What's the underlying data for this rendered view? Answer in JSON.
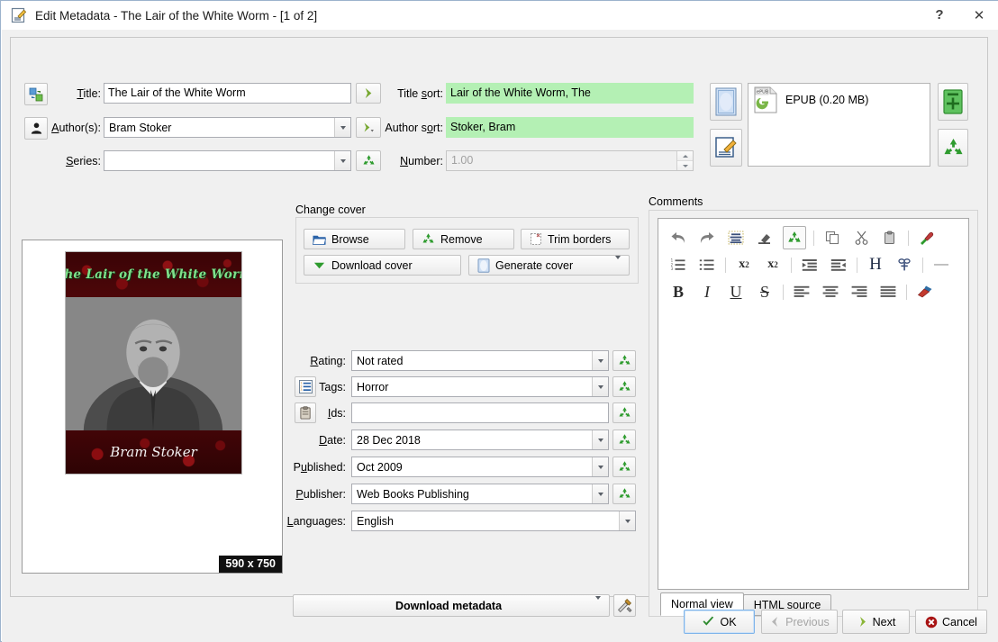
{
  "window": {
    "title": "Edit Metadata - The Lair of the White Worm -  [1 of 2]",
    "help_label": "?",
    "close_label": "✕"
  },
  "fields": {
    "title_label": "Title:",
    "title_value": "The Lair of the White Worm",
    "title_sort_label": "Title sort:",
    "title_sort_value": "Lair of the White Worm, The",
    "authors_label": "Author(s):",
    "authors_value": "Bram Stoker",
    "author_sort_label": "Author sort:",
    "author_sort_value": "Stoker, Bram",
    "series_label": "Series:",
    "series_value": "",
    "number_label": "Number:",
    "number_value": "1.00"
  },
  "formats": {
    "items": [
      {
        "name": "EPUB (0.20 MB)",
        "badge": "ePUB"
      }
    ]
  },
  "change_cover": {
    "group_label": "Change cover",
    "browse_label": "Browse",
    "remove_label": "Remove",
    "trim_label": "Trim borders",
    "download_label": "Download cover",
    "generate_label": "Generate cover"
  },
  "cover": {
    "title_text": "The Lair of the White Worm",
    "author_text": "Bram Stoker",
    "dimensions": "590 x 750"
  },
  "metadata": {
    "rating_label": "Rating:",
    "rating_value": "Not rated",
    "tags_label": "Tags:",
    "tags_value": "Horror",
    "ids_label": "Ids:",
    "ids_value": "",
    "date_label": "Date:",
    "date_value": "28 Dec 2018",
    "published_label": "Published:",
    "published_value": "Oct 2009",
    "publisher_label": "Publisher:",
    "publisher_value": "Web Books Publishing",
    "languages_label": "Languages:",
    "languages_value": "English",
    "download_metadata_label": "Download metadata"
  },
  "comments": {
    "group_label": "Comments",
    "body_text": "",
    "toolbar": {
      "row1": [
        {
          "icon": "undo-icon",
          "glyph": "⮏"
        },
        {
          "icon": "redo-icon",
          "glyph": "⮐"
        },
        {
          "icon": "remove-formatting-icon",
          "glyph": "≡"
        },
        {
          "icon": "eraser-icon",
          "glyph": "◢"
        },
        {
          "icon": "recycle-icon",
          "glyph": "♻"
        },
        {
          "icon": "copy-icon",
          "glyph": "⧉"
        },
        {
          "icon": "cut-icon",
          "glyph": "✂"
        },
        {
          "icon": "paste-icon",
          "glyph": "Ὄb"
        },
        {
          "icon": "paste-formatted-icon",
          "glyph": "✐"
        }
      ],
      "row2": [
        {
          "icon": "ordered-list-icon",
          "glyph": "≡"
        },
        {
          "icon": "unordered-list-icon",
          "glyph": "≡"
        },
        {
          "icon": "superscript-icon",
          "glyph": "x²"
        },
        {
          "icon": "subscript-icon",
          "glyph": "x₂"
        },
        {
          "icon": "indent-icon",
          "glyph": "⇥"
        },
        {
          "icon": "outdent-icon",
          "glyph": "⇤"
        },
        {
          "icon": "heading-icon",
          "glyph": "H"
        },
        {
          "icon": "insert-link-icon",
          "glyph": "⚭"
        },
        {
          "icon": "horizontal-rule-icon",
          "glyph": "—"
        }
      ],
      "row3": [
        {
          "icon": "bold-icon",
          "glyph": "B"
        },
        {
          "icon": "italic-icon",
          "glyph": "I"
        },
        {
          "icon": "underline-icon",
          "glyph": "U"
        },
        {
          "icon": "strikethrough-icon",
          "glyph": "S"
        },
        {
          "icon": "align-left-icon",
          "glyph": "≡"
        },
        {
          "icon": "align-center-icon",
          "glyph": "≡"
        },
        {
          "icon": "align-right-icon",
          "glyph": "≡"
        },
        {
          "icon": "justify-icon",
          "glyph": "≡"
        },
        {
          "icon": "background-color-icon",
          "glyph": "✎"
        }
      ]
    },
    "tabs": [
      {
        "label": "Normal view",
        "active": true
      },
      {
        "label": "HTML source",
        "active": false
      }
    ]
  },
  "footer": {
    "ok_label": "OK",
    "previous_label": "Previous",
    "next_label": "Next",
    "cancel_label": "Cancel"
  },
  "colors": {
    "accent_green": "#b4f0b4",
    "recycle_green": "#2e9b2e",
    "cancel_red": "#a81414",
    "default_border": "#7eb4ea",
    "dialog_bg": "#f0f0f0"
  }
}
